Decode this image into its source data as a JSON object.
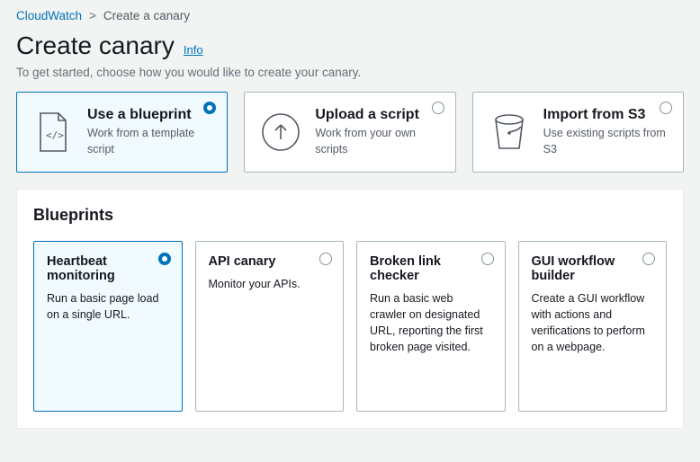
{
  "breadcrumb": {
    "root": "CloudWatch",
    "sep": ">",
    "current": "Create a canary"
  },
  "header": {
    "title": "Create canary",
    "info": "Info",
    "subtitle": "To get started, choose how you would like to create your canary."
  },
  "methods": [
    {
      "title": "Use a blueprint",
      "desc": "Work from a template script",
      "selected": true,
      "icon": "blueprint-file-icon"
    },
    {
      "title": "Upload a script",
      "desc": "Work from your own scripts",
      "selected": false,
      "icon": "upload-arrow-icon"
    },
    {
      "title": "Import from S3",
      "desc": "Use existing scripts from S3",
      "selected": false,
      "icon": "bucket-icon"
    }
  ],
  "blueprints_section": {
    "title": "Blueprints"
  },
  "blueprints": [
    {
      "title": "Heartbeat monitoring",
      "desc": "Run a basic page load on a single URL.",
      "selected": true
    },
    {
      "title": "API canary",
      "desc": "Monitor your APIs.",
      "selected": false
    },
    {
      "title": "Broken link checker",
      "desc": "Run a basic web crawler on designated URL, reporting the first broken page visited.",
      "selected": false
    },
    {
      "title": "GUI workflow builder",
      "desc": "Create a GUI workflow with actions and verifications to perform on a webpage.",
      "selected": false
    }
  ]
}
